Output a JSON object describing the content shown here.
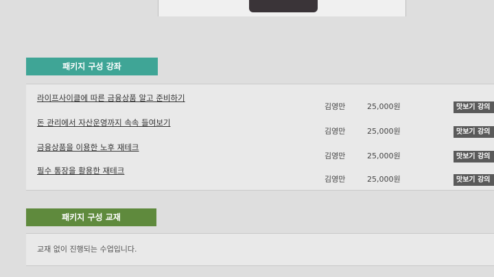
{
  "courses_section": {
    "title": "패키지 구성 강좌",
    "items": [
      {
        "title": "라이프사이클에 따른 금융상품 알고 준비하기",
        "teacher": "김영만",
        "price": "25,000원",
        "preview": "맛보기 강의"
      },
      {
        "title": "돈 관리에서 자산운영까지 속속 들여보기",
        "teacher": "김영만",
        "price": "25,000원",
        "preview": "맛보기 강의"
      },
      {
        "title": "금융상품을 이용한 노후 재테크",
        "teacher": "김영만",
        "price": "25,000원",
        "preview": "맛보기 강의"
      },
      {
        "title": "필수 통장을 활용한 재테크",
        "teacher": "김영만",
        "price": "25,000원",
        "preview": "맛보기 강의"
      }
    ]
  },
  "books_section": {
    "title": "패키지 구성 교재",
    "note": "교재 없이 진행되는 수업입니다."
  },
  "colors": {
    "courses_tab": "#3fa596",
    "books_tab": "#5f8a3d",
    "preview_button": "#5a5a5a"
  }
}
